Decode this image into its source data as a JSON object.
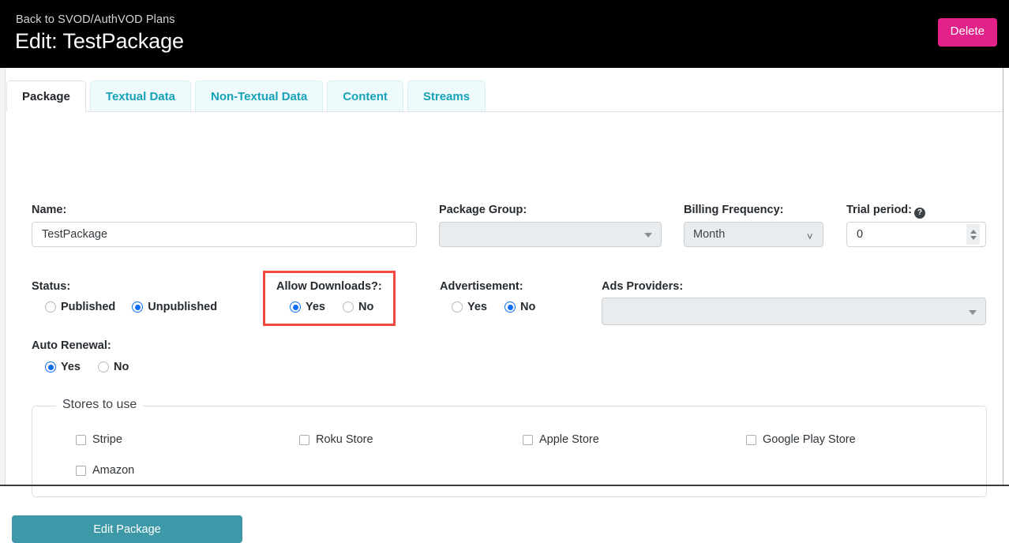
{
  "header": {
    "back_link": "Back to SVOD/AuthVOD Plans",
    "title": "Edit: TestPackage",
    "delete_label": "Delete",
    "delete_color": "#e3218b",
    "background": "#000000"
  },
  "tabs": [
    {
      "label": "Package",
      "active": true
    },
    {
      "label": "Textual Data",
      "active": false
    },
    {
      "label": "Non-Textual Data",
      "active": false
    },
    {
      "label": "Content",
      "active": false
    },
    {
      "label": "Streams",
      "active": false
    }
  ],
  "tab_colors": {
    "active_text": "#212529",
    "inactive_text": "#16a2b8",
    "inactive_bg": "#eefafb"
  },
  "form": {
    "name": {
      "label": "Name:",
      "value": "TestPackage",
      "placeholder": ""
    },
    "package_group": {
      "label": "Package Group:",
      "value": "",
      "placeholder": ""
    },
    "billing_frequency": {
      "label": "Billing Frequency:",
      "value": "Month",
      "options": [
        "Month"
      ]
    },
    "trial_period": {
      "label": "Trial period:",
      "value": "0",
      "help_icon": "question-circle-icon"
    },
    "status": {
      "label": "Status:",
      "options": [
        {
          "label": "Published",
          "selected": false
        },
        {
          "label": "Unpublished",
          "selected": true
        }
      ]
    },
    "allow_downloads": {
      "label": "Allow Downloads?:",
      "highlighted": true,
      "highlight_color": "#f0493e",
      "options": [
        {
          "label": "Yes",
          "selected": true
        },
        {
          "label": "No",
          "selected": false
        }
      ]
    },
    "advertisement": {
      "label": "Advertisement:",
      "options": [
        {
          "label": "Yes",
          "selected": false
        },
        {
          "label": "No",
          "selected": true
        }
      ]
    },
    "ads_providers": {
      "label": "Ads Providers:",
      "value": "",
      "placeholder": ""
    },
    "auto_renewal": {
      "label": "Auto Renewal:",
      "options": [
        {
          "label": "Yes",
          "selected": true
        },
        {
          "label": "No",
          "selected": false
        }
      ]
    },
    "stores": {
      "legend": "Stores to use",
      "items": [
        {
          "label": "Stripe",
          "checked": false
        },
        {
          "label": "Roku Store",
          "checked": false
        },
        {
          "label": "Apple Store",
          "checked": false
        },
        {
          "label": "Google Play Store",
          "checked": false
        },
        {
          "label": "Amazon",
          "checked": false
        }
      ]
    },
    "submit_label": "Edit Package",
    "submit_color": "#3d98a8"
  }
}
